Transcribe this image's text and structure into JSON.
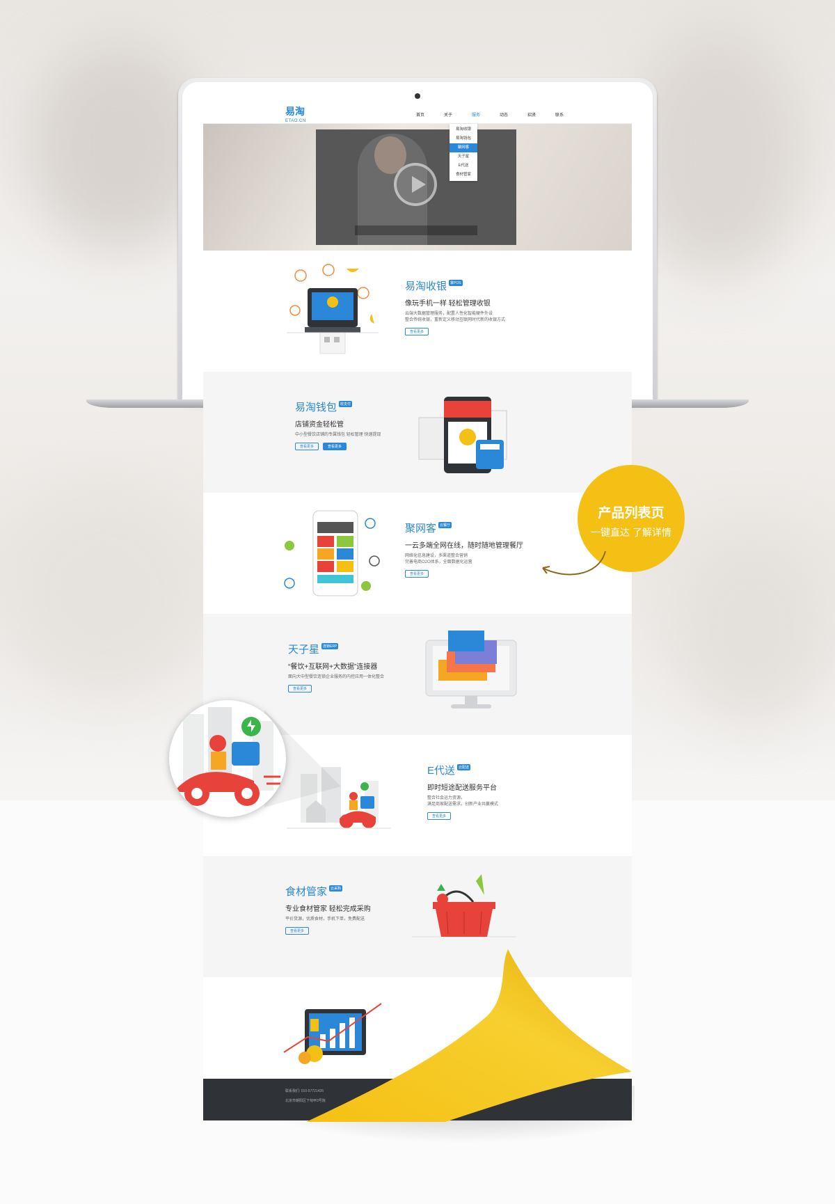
{
  "nav": {
    "logo": "易淘",
    "logo_sub": "ETAO.CN",
    "items": [
      "首页",
      "关于",
      "服务",
      "动态",
      "招贤",
      "联系"
    ],
    "active": "服务",
    "dropdown": [
      "易淘收银",
      "易淘钱包",
      "聚网客",
      "天子星",
      "E代送",
      "食材管家"
    ],
    "dropdown_selected": "聚网客"
  },
  "products": [
    {
      "title": "易淘收银",
      "tag": "掌POS",
      "subtitle": "像玩手机一样 轻松管理收银",
      "desc": "云端大数据管理服务，配置人性化智能硬件外设\n整合传统收银，重新定义移动互联网时代新的收银方式",
      "more": "查看更多"
    },
    {
      "title": "易淘钱包",
      "tag": "收支付",
      "subtitle": "店铺资金轻松管",
      "desc": "中小型餐饮店铺的专属钱包  轻松管理  快速提现",
      "more": "查看更多",
      "more2": "查看更多"
    },
    {
      "title": "聚网客",
      "tag": "云餐厅",
      "subtitle": "一云多端全网在线，随时随地管理餐厅",
      "desc": "网络化信息建设，多渠道整合营销\n完善电商O2O体系，全面数据化运营",
      "more": "查看更多"
    },
    {
      "title": "天子星",
      "tag": "连锁ERP",
      "subtitle": "“餐饮+互联网+大数据”连接器",
      "desc": "面向大中型餐饮连锁企业服务的内控应用一体化整合",
      "more": "查看更多"
    },
    {
      "title": "E代送",
      "tag": "云配送",
      "subtitle": "即时短途配送服务平台",
      "desc": "整合社会运力资源，\n满足商家配送需求，创新产业共赢模式",
      "more": "查看更多"
    },
    {
      "title": "食材管家",
      "tag": "云采购",
      "subtitle": "专业食材管家  轻松完成采购",
      "desc": "平价货源，优质食材，手机下单，免费配送",
      "more": "查看更多"
    }
  ],
  "footer": {
    "line1": "联系我们: 010-57721426",
    "line2": "北京市朝阳区下甸甲3号院"
  },
  "callout": {
    "title": "产品列表页",
    "subtitle": "一键直达  了解详情"
  },
  "colors": {
    "brand_blue": "#2b88d8",
    "accent_yellow": "#f5c014",
    "footer_dark": "#2f3338"
  }
}
